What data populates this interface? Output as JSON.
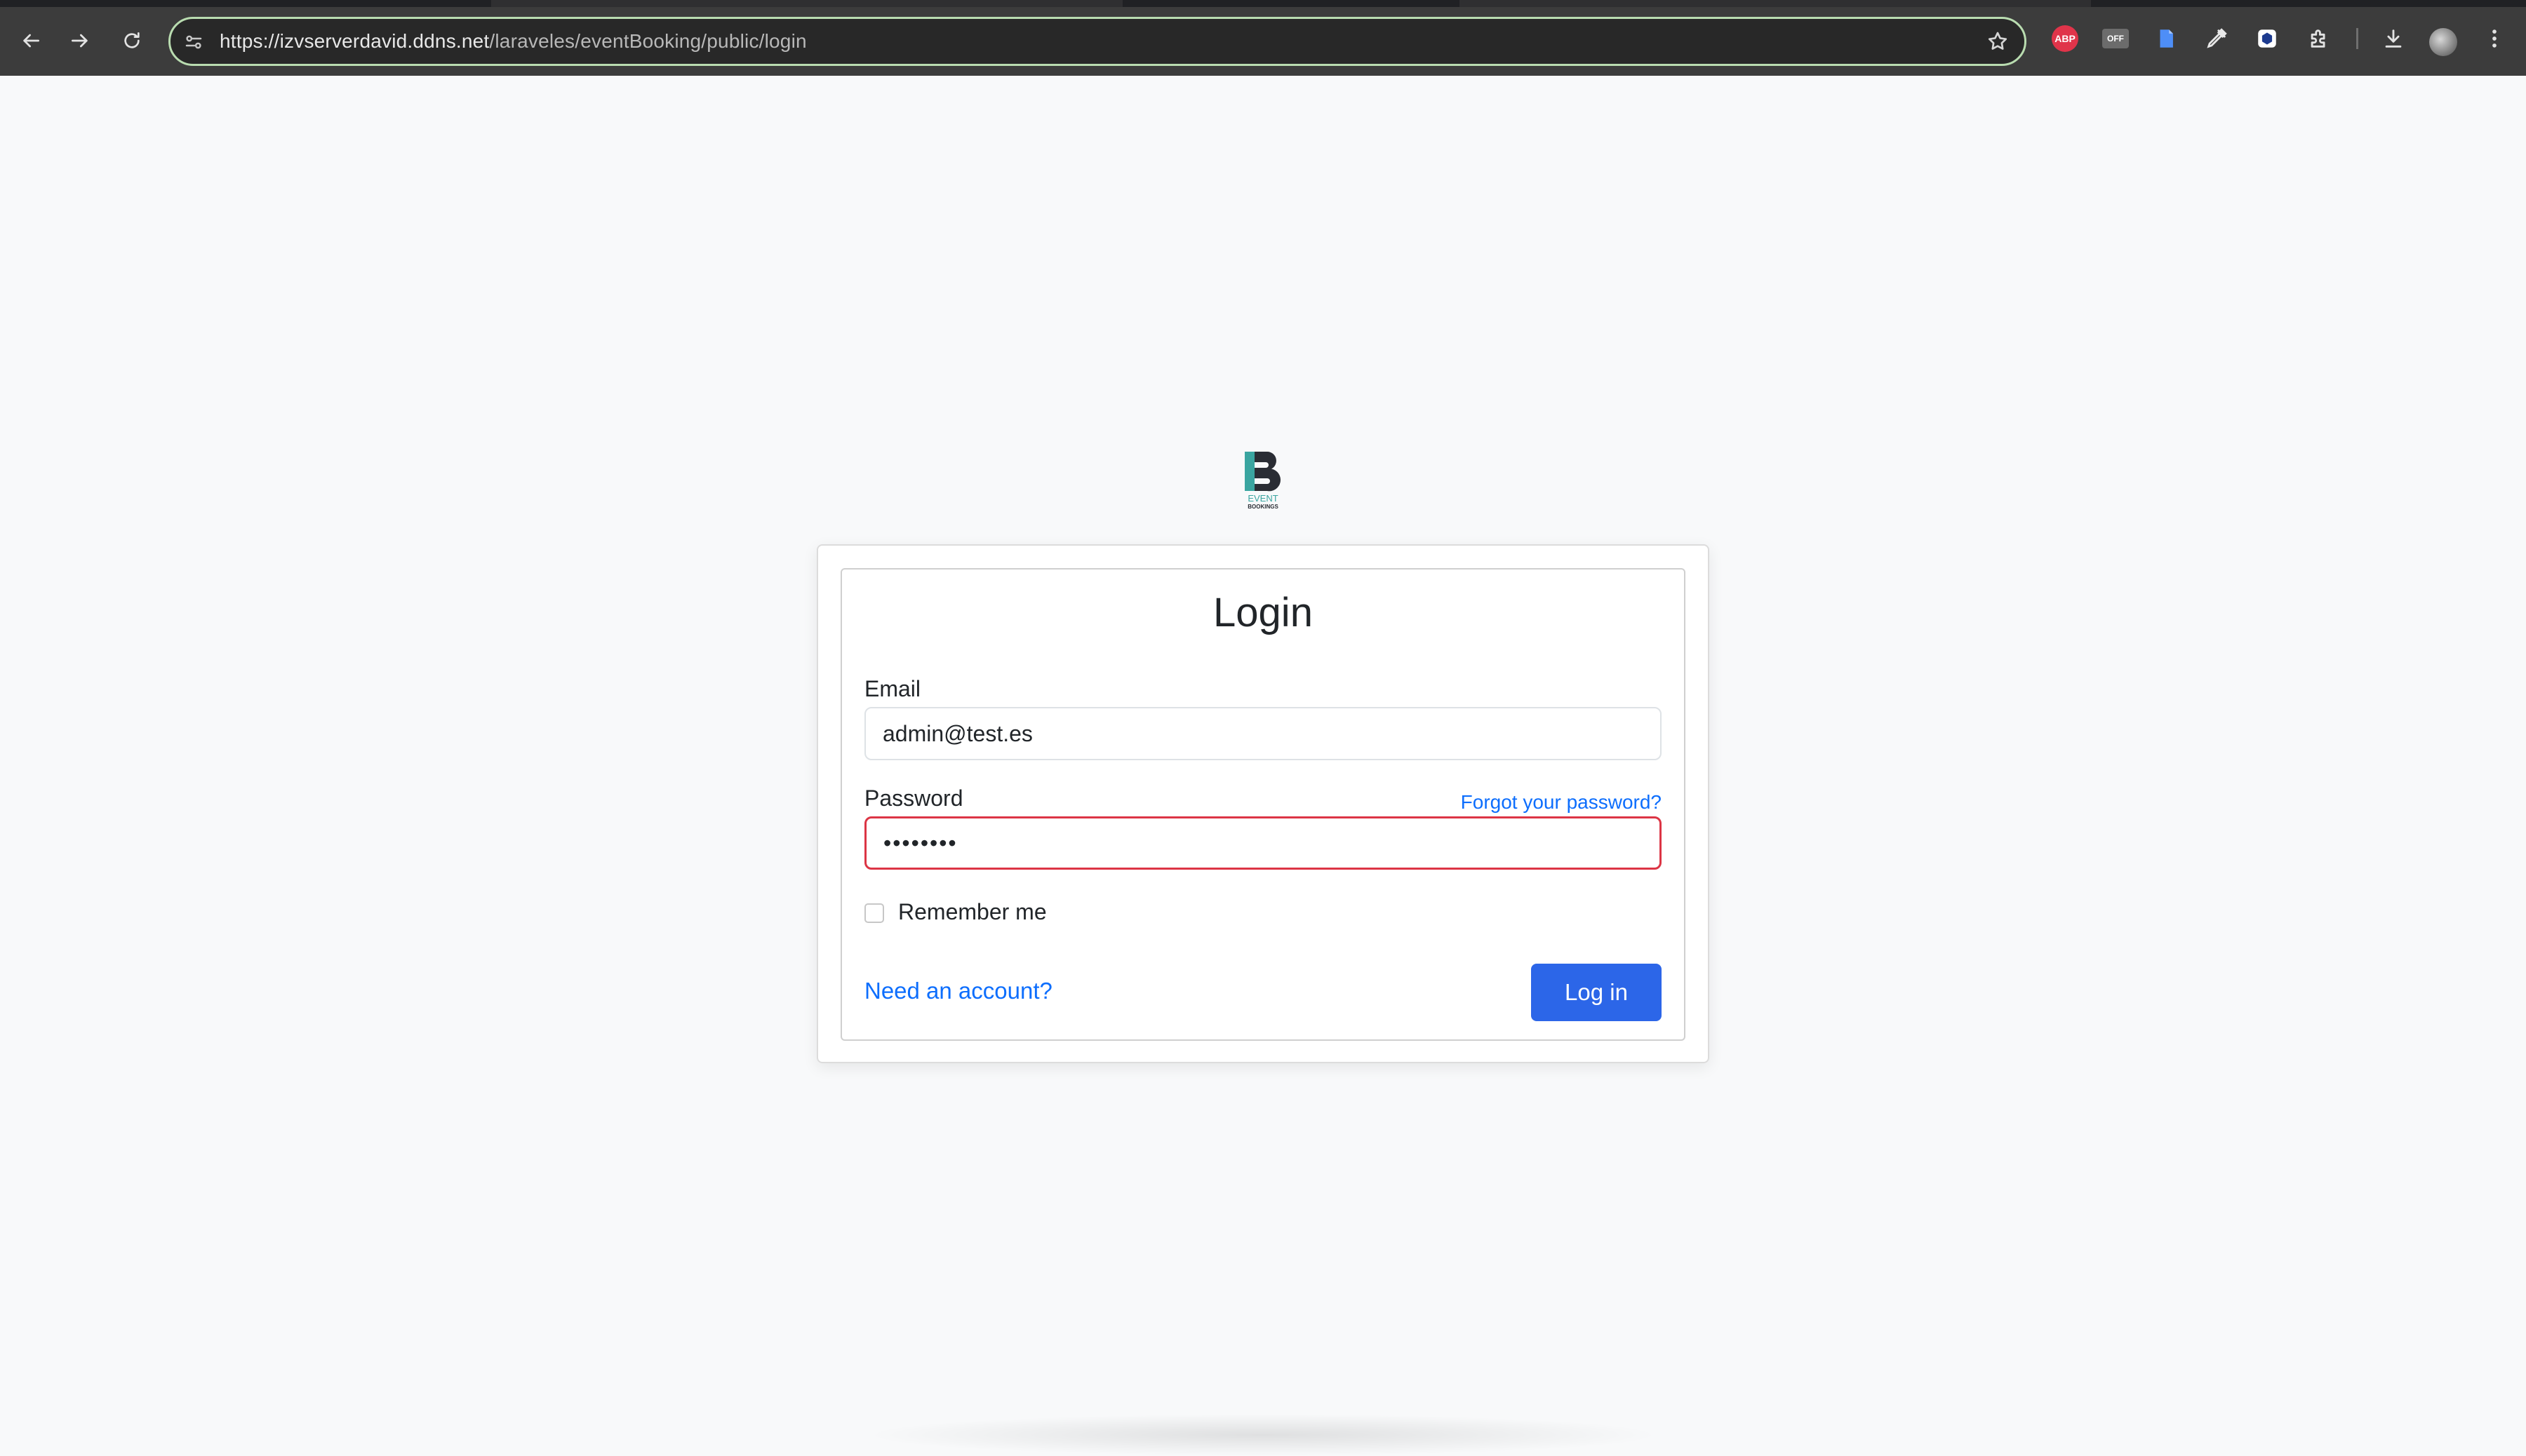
{
  "browser": {
    "url_host": "https://izvserverdavid.ddns.net",
    "url_path": "/laraveles/eventBooking/public/login",
    "extensions": [
      "ABP",
      "OFF"
    ]
  },
  "logo": {
    "text_top": "EVENT",
    "text_bottom": "BOOKINGS",
    "accent_color": "#3aa5a0"
  },
  "login_form": {
    "title": "Login",
    "email_label": "Email",
    "email_value": "admin@test.es",
    "password_label": "Password",
    "password_value": "••••••••",
    "forgot_link": "Forgot your password?",
    "remember_label": "Remember me",
    "remember_checked": false,
    "account_link": "Need an account?",
    "submit_label": "Log in"
  },
  "colors": {
    "primary": "#2c66e8",
    "link": "#0d6efd",
    "invalid": "#dc3545",
    "background": "#f8f9fa"
  }
}
